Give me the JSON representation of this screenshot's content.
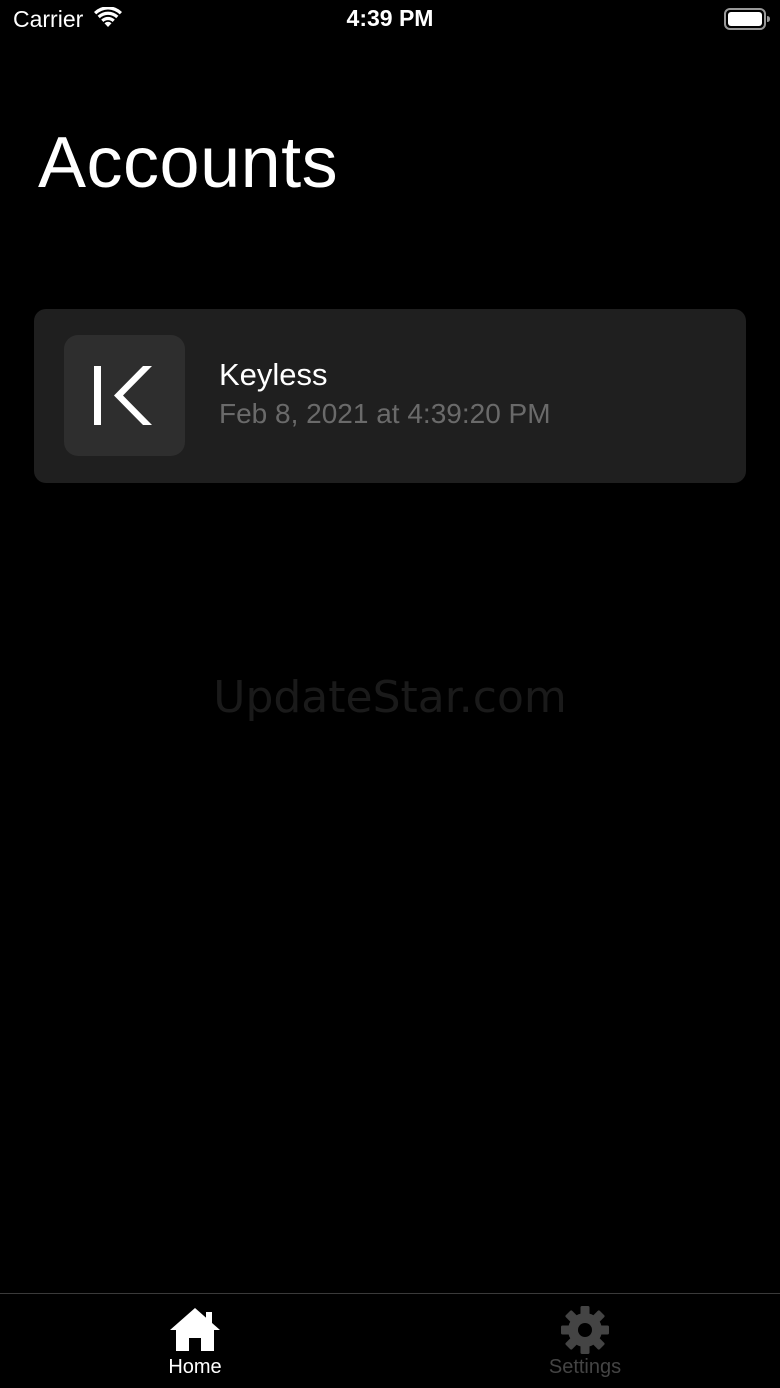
{
  "status_bar": {
    "carrier": "Carrier",
    "time": "4:39 PM",
    "icons": [
      "wifi-icon",
      "battery-icon"
    ]
  },
  "page": {
    "title": "Accounts"
  },
  "accounts": [
    {
      "name": "Keyless",
      "date": "Feb 8, 2021 at 4:39:20 PM",
      "logo_icon": "keyless-logo-icon"
    }
  ],
  "watermark": "UpdateStar.com",
  "tab_bar": {
    "tabs": [
      {
        "label": "Home",
        "icon": "home-icon",
        "active": true
      },
      {
        "label": "Settings",
        "icon": "gear-icon",
        "active": false
      }
    ]
  },
  "colors": {
    "background": "#000000",
    "card": "#1f1f1f",
    "logo_bg": "#2e2e2e",
    "secondary_text": "#6a6a6a",
    "inactive_tab": "#444444"
  }
}
